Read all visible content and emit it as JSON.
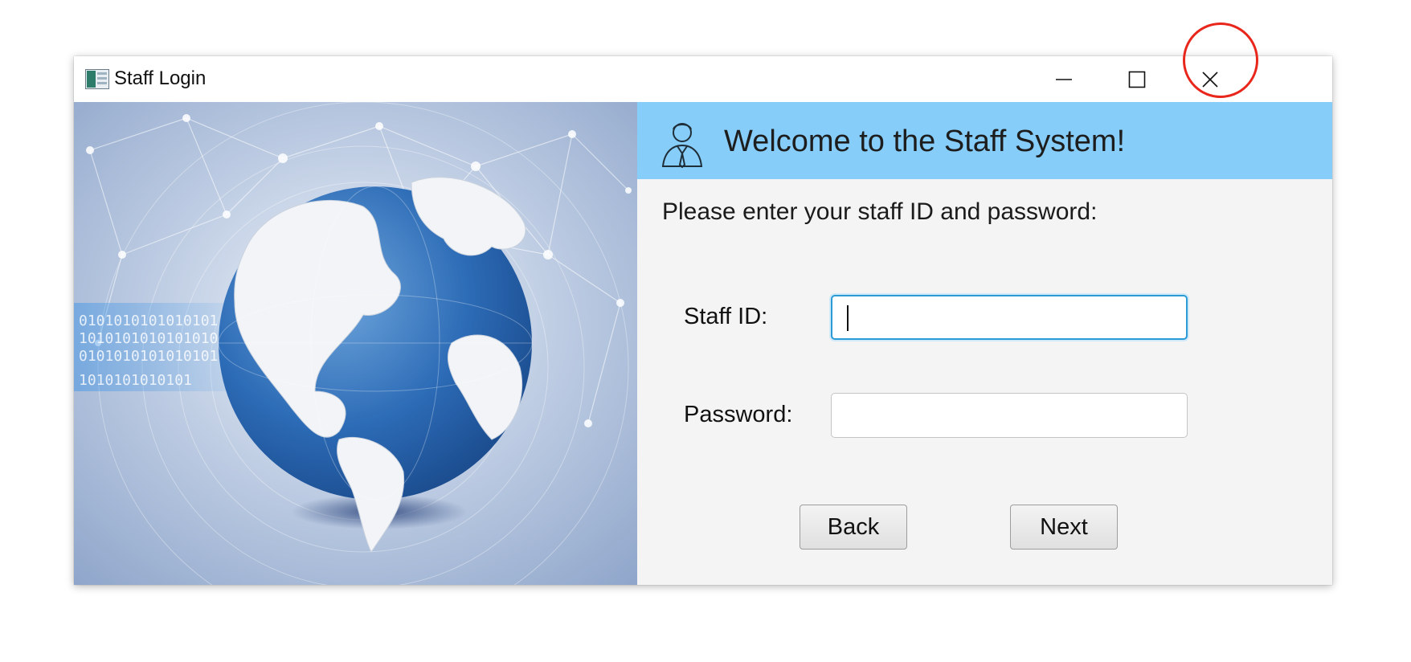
{
  "window": {
    "title": "Staff Login",
    "controls": {
      "minimize": "minimize",
      "maximize": "maximize",
      "close": "close"
    }
  },
  "banner": {
    "text": "Welcome to the Staff System!"
  },
  "form": {
    "prompt": "Please enter your staff ID and password:",
    "staff_id_label": "Staff ID:",
    "staff_id_value": "",
    "password_label": "Password:",
    "password_value": ""
  },
  "buttons": {
    "back": "Back",
    "next": "Next"
  },
  "colors": {
    "banner_bg": "#87cdf9",
    "focus_border": "#2b9bd6",
    "highlight_ring": "#e8261b"
  }
}
